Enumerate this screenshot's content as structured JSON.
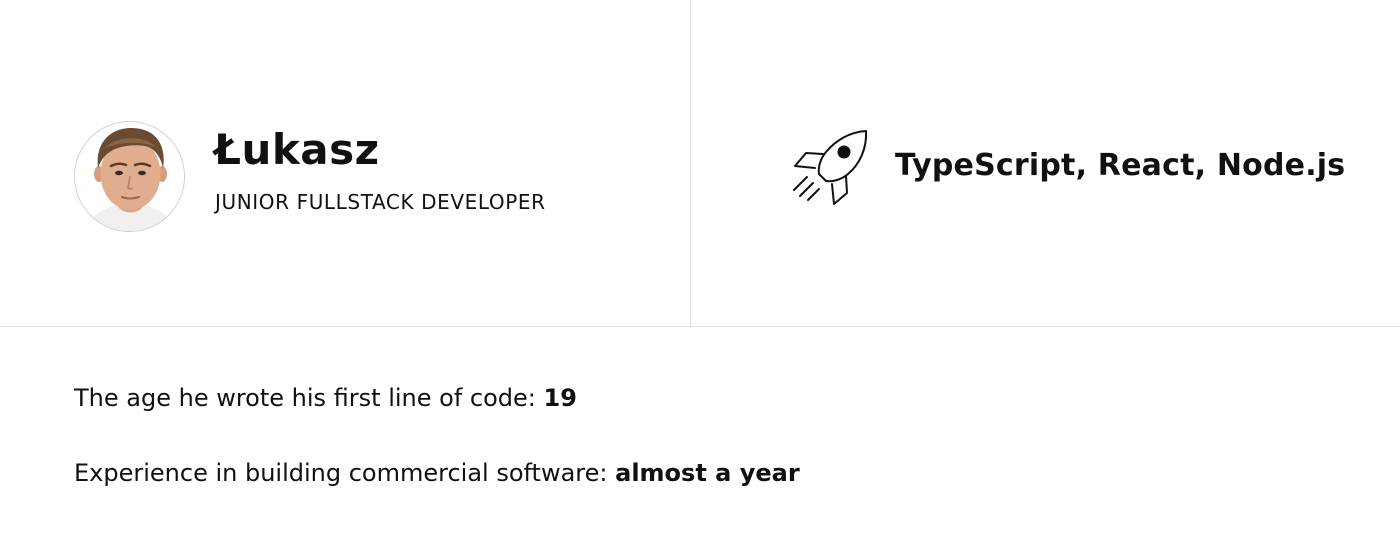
{
  "profile": {
    "name": "Łukasz",
    "role": "JUNIOR FULLSTACK DEVELOPER",
    "avatar_icon": "person-portrait-avatar"
  },
  "tech": {
    "icon": "rocket-icon",
    "stack": "TypeScript, React, Node.js"
  },
  "facts": [
    {
      "label": "The age he wrote his first line of code: ",
      "value": "19"
    },
    {
      "label": "Experience in building commercial software: ",
      "value": "almost a year"
    }
  ],
  "colors": {
    "text": "#111111",
    "divider": "#e2e2e2",
    "background": "#ffffff"
  }
}
